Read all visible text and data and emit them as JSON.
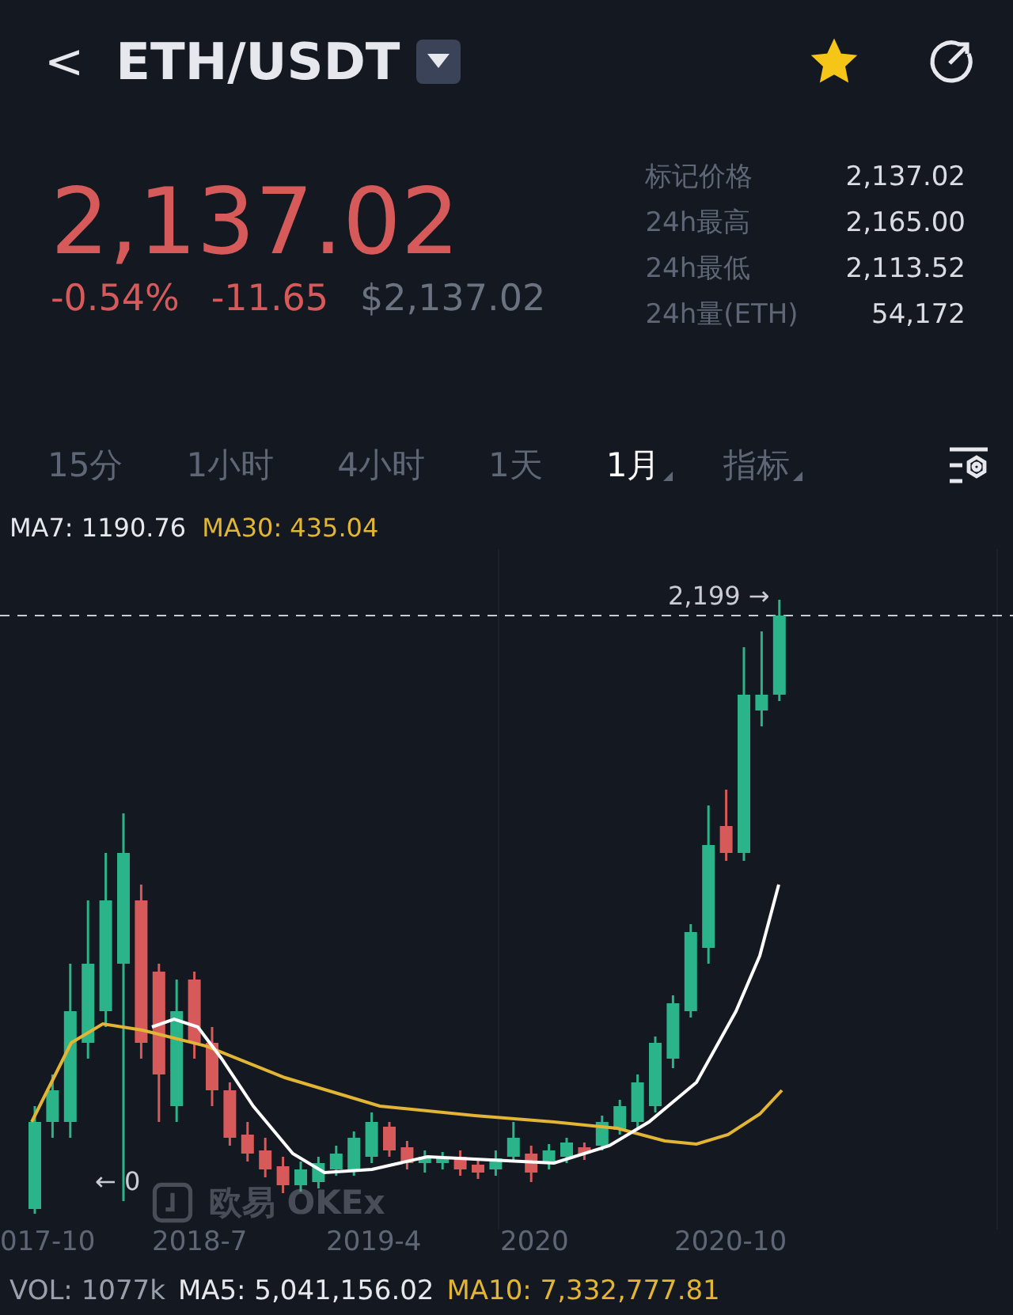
{
  "header": {
    "back": "<",
    "pair": "ETH/USDT",
    "favorite": true
  },
  "price": {
    "last": "2,137.02",
    "change_pct": "-0.54%",
    "change": "-11.65",
    "usd": "$2,137.02"
  },
  "stats": [
    {
      "label": "标记价格",
      "value": "2,137.02"
    },
    {
      "label": "24h最高",
      "value": "2,165.00"
    },
    {
      "label": "24h最低",
      "value": "2,113.52"
    },
    {
      "label": "24h量(ETH)",
      "value": "54,172"
    }
  ],
  "intervals": [
    {
      "label": "15分",
      "selected": false,
      "dropdown": false
    },
    {
      "label": "1小时",
      "selected": false,
      "dropdown": false
    },
    {
      "label": "4小时",
      "selected": false,
      "dropdown": false
    },
    {
      "label": "1天",
      "selected": false,
      "dropdown": false
    },
    {
      "label": "1月",
      "selected": true,
      "dropdown": true
    },
    {
      "label": "指标",
      "selected": false,
      "dropdown": true
    }
  ],
  "chart": {
    "ma7": "MA7: 1190.76",
    "ma30": "MA30: 435.04",
    "high_marker": "2,199 →",
    "low_marker": "← 0",
    "watermark": "欧易 OKEx",
    "dates": [
      "017-10",
      "2018-7",
      "2019-4",
      "2020",
      "2020-10"
    ]
  },
  "volume": {
    "vol": "VOL: 1077k",
    "ma5": "MA5: 5,041,156.02",
    "ma10": "MA10: 7,332,777.81"
  }
}
